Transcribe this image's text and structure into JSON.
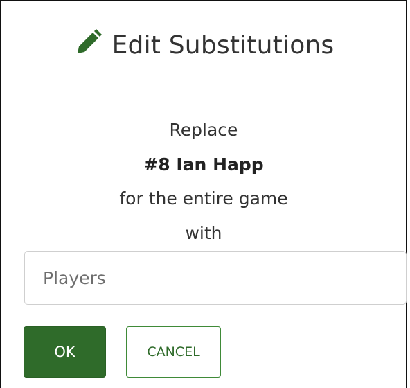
{
  "dialog": {
    "title": "Edit Substitutions",
    "title_icon": "pencil-icon",
    "accent_color": "#2f6b2a"
  },
  "message": {
    "replace_label": "Replace",
    "player_name": "#8 Ian Happ",
    "scope_text": "for the entire game",
    "with_label": "with"
  },
  "players_field": {
    "placeholder": "Players",
    "value": ""
  },
  "buttons": {
    "ok_label": "OK",
    "cancel_label": "CANCEL"
  }
}
